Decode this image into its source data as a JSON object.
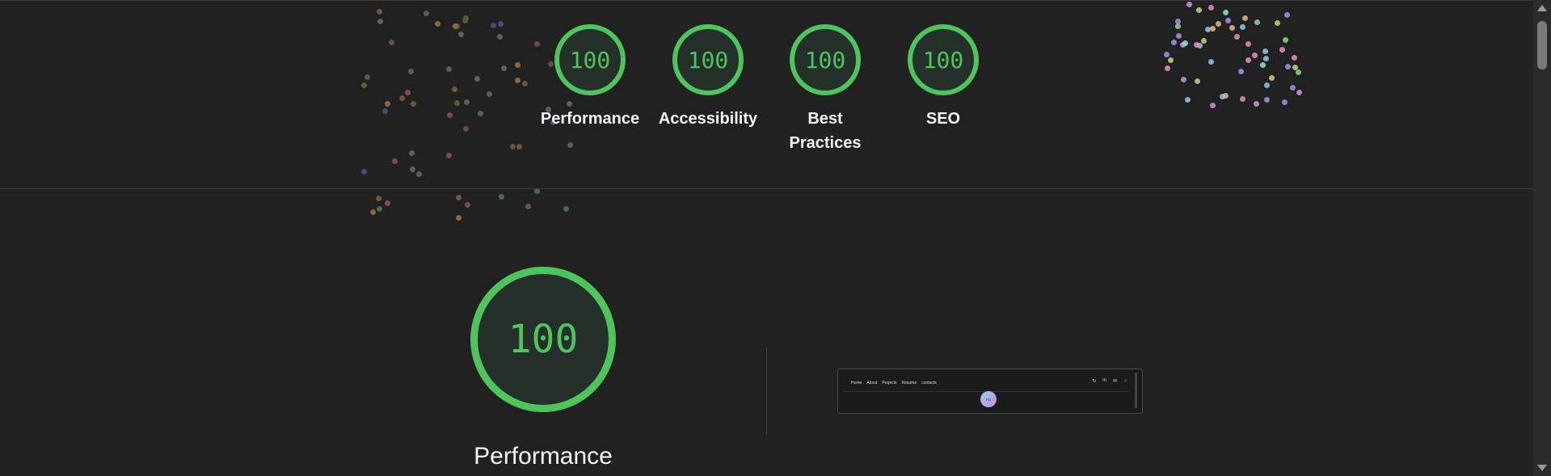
{
  "colors": {
    "background": "#212121",
    "score_good": "#4ec55c",
    "gauge_fill": "#25302a"
  },
  "summary": {
    "items": [
      {
        "score": "100",
        "label": "Performance"
      },
      {
        "score": "100",
        "label": "Accessibility"
      },
      {
        "score": "100",
        "label": "Best Practices"
      },
      {
        "score": "100",
        "label": "SEO"
      }
    ]
  },
  "category": {
    "score": "100",
    "title": "Performance"
  },
  "screenshot": {
    "nav": [
      "Home",
      "About",
      "Projects",
      "Resume",
      "contacts"
    ],
    "avatar_text": "PG"
  }
}
